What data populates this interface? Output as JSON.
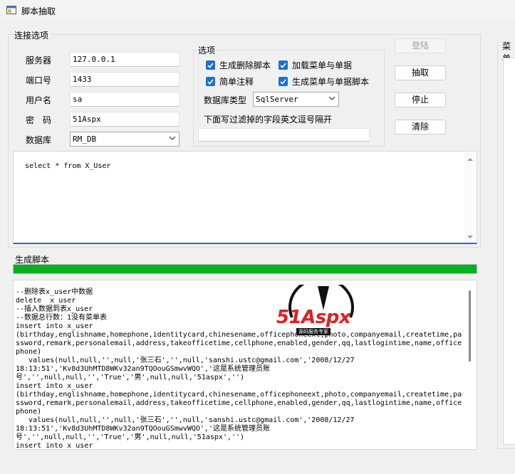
{
  "window": {
    "title": "脚本抽取"
  },
  "connection": {
    "legend": "连接选项",
    "server_label": "服务器",
    "server_value": "127.0.0.1",
    "port_label": "端口号",
    "port_value": "1433",
    "user_label": "用户名",
    "user_value": "sa",
    "password_label": "密　码",
    "password_value": "51Aspx",
    "database_label": "数据库",
    "database_value": "RM_DB"
  },
  "options": {
    "legend": "选项",
    "gen_delete_label": "生成删除脚本",
    "gen_delete_checked": true,
    "load_menu_label": "加载菜单与单据",
    "load_menu_checked": true,
    "simple_comment_label": "简单注释",
    "simple_comment_checked": true,
    "gen_menu_script_label": "生成菜单与单据脚本",
    "gen_menu_script_checked": true,
    "db_type_label": "数据库类型",
    "db_type_value": "SqlServer",
    "filter_label": "下面写过滤掉的字段英文逗号隔开",
    "filter_value": ""
  },
  "buttons": {
    "login": "登陆",
    "extract": "抽取",
    "stop": "停止",
    "clear": "清除"
  },
  "query": {
    "text": "select * from X_User"
  },
  "output": {
    "legend": "生成脚本",
    "progress_percent": 100,
    "lines": [
      "--删除表x_user中数据",
      "delete  x_user",
      "--插入数据到表x_user",
      "--数据总行数：1没有菜单表",
      "insert into x_user",
      "(birthday,englishname,homephone,identitycard,chinesename,officephoneext,photo,companyemail,createtime,pa",
      "ssword,remark,personalemail,address,takeofficetime,cellphone,enabled,gender,qq,lastlogintime,name,office",
      "phone)",
      "   values(null,null,'',null,'张三石','',null,'sanshi.ustc@gmail.com','2008/12/27",
      "18:13:51','Kv8d3UhMTD8WKv32an9TQOouGSmwvWQO','这是系统管理员账",
      "号','',null,null,'','True','男',null,null,'51aspx','')",
      "insert into x_user",
      "(birthday,englishname,homephone,identitycard,chinesename,officephoneext,photo,companyemail,createtime,pa",
      "ssword,remark,personalemail,address,takeofficetime,cellphone,enabled,gender,qq,lastlogintime,name,office",
      "phone)",
      "   values(null,null,'',null,'张三石','',null,'sanshi.ustc@gmail.com','2008/12/27",
      "18:13:51','Kv8d3UhMTD8WKv32an9TQOouGSmwvWQO','这是系统管理员账",
      "号','',null,null,'','True','男',null,null,'51aspx','')",
      "insert into x_user"
    ]
  },
  "watermark": {
    "brand": "51Aspx",
    "tagline": "源码服务专家"
  },
  "menu_panel": {
    "legend": "菜单"
  },
  "icons": {
    "app": "app-window-icon",
    "check": "check-icon",
    "dropdown": "chevron-down-icon",
    "scroll_up": "scroll-up-arrow-icon",
    "scroll_down": "scroll-down-arrow-icon"
  },
  "colors": {
    "accent": "#1f6fd0",
    "progress": "#06b025",
    "watermark_red": "#e02020"
  }
}
